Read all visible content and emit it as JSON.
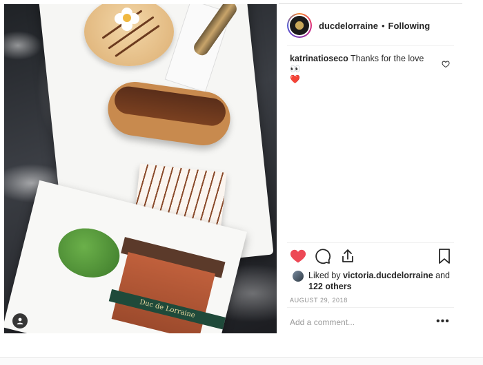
{
  "post": {
    "author": "ducdelorraine",
    "separator": "•",
    "follow_status": "Following",
    "image_alt_sign": "Duc de Lorraine"
  },
  "comments": [
    {
      "user": "katrinatioseco",
      "text": "Thanks for the love 👀",
      "emoji_after": "❤️"
    }
  ],
  "likes": {
    "prefix": "Liked by",
    "user": "victoria.ducdelorraine",
    "middle": "and",
    "others": "122 others"
  },
  "date": "AUGUST 29, 2018",
  "add_comment": {
    "placeholder": "Add a comment..."
  },
  "more_label": "•••",
  "colors": {
    "like_red": "#ed4956",
    "text": "#262626",
    "muted": "#8e8e8e"
  },
  "icons": [
    "heart-filled-icon",
    "comment-icon",
    "share-icon",
    "bookmark-icon",
    "heart-outline-icon",
    "user-tag-icon",
    "more-icon"
  ]
}
